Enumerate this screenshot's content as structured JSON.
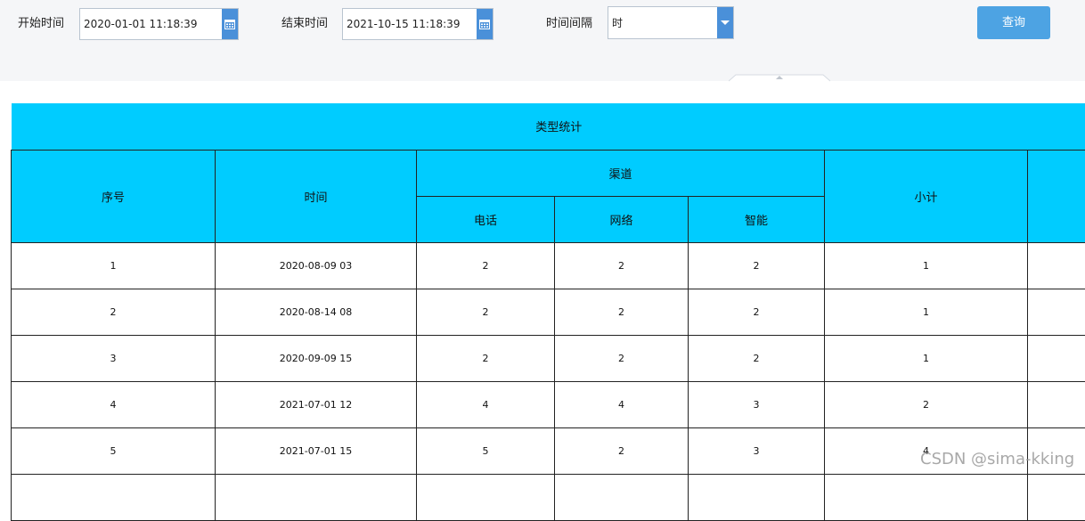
{
  "filters": {
    "start_label": "开始时间",
    "start_value": "2020-01-01 11:18:39",
    "end_label": "结束时间",
    "end_value": "2021-10-15 11:18:39",
    "interval_label": "时间间隔",
    "interval_value": "时",
    "query_label": "查询"
  },
  "table": {
    "title": "类型统计",
    "headers": {
      "index": "序号",
      "time": "时间",
      "channel": "渠道",
      "phone": "电话",
      "network": "网络",
      "smart": "智能",
      "subtotal": "小计"
    },
    "rows": [
      {
        "index": "1",
        "time": "2020-08-09 03",
        "phone": "2",
        "network": "2",
        "smart": "2",
        "subtotal": "1",
        "extra": ""
      },
      {
        "index": "2",
        "time": "2020-08-14 08",
        "phone": "2",
        "network": "2",
        "smart": "2",
        "subtotal": "1",
        "extra": ""
      },
      {
        "index": "3",
        "time": "2020-09-09 15",
        "phone": "2",
        "network": "2",
        "smart": "2",
        "subtotal": "1",
        "extra": ""
      },
      {
        "index": "4",
        "time": "2021-07-01 12",
        "phone": "4",
        "network": "4",
        "smart": "3",
        "subtotal": "2",
        "extra": ""
      },
      {
        "index": "5",
        "time": "2021-07-01 15",
        "phone": "5",
        "network": "2",
        "smart": "3",
        "subtotal": "4",
        "extra": ""
      }
    ]
  },
  "watermark": "CSDN @sima-kking",
  "colors": {
    "header_bg": "#00ccff",
    "accent": "#4a90d9",
    "query_bg": "#4da3e3",
    "filter_bg": "#f5f6f8"
  },
  "icons": {
    "calendar": "calendar-icon",
    "dropdown": "chevron-down-icon"
  }
}
